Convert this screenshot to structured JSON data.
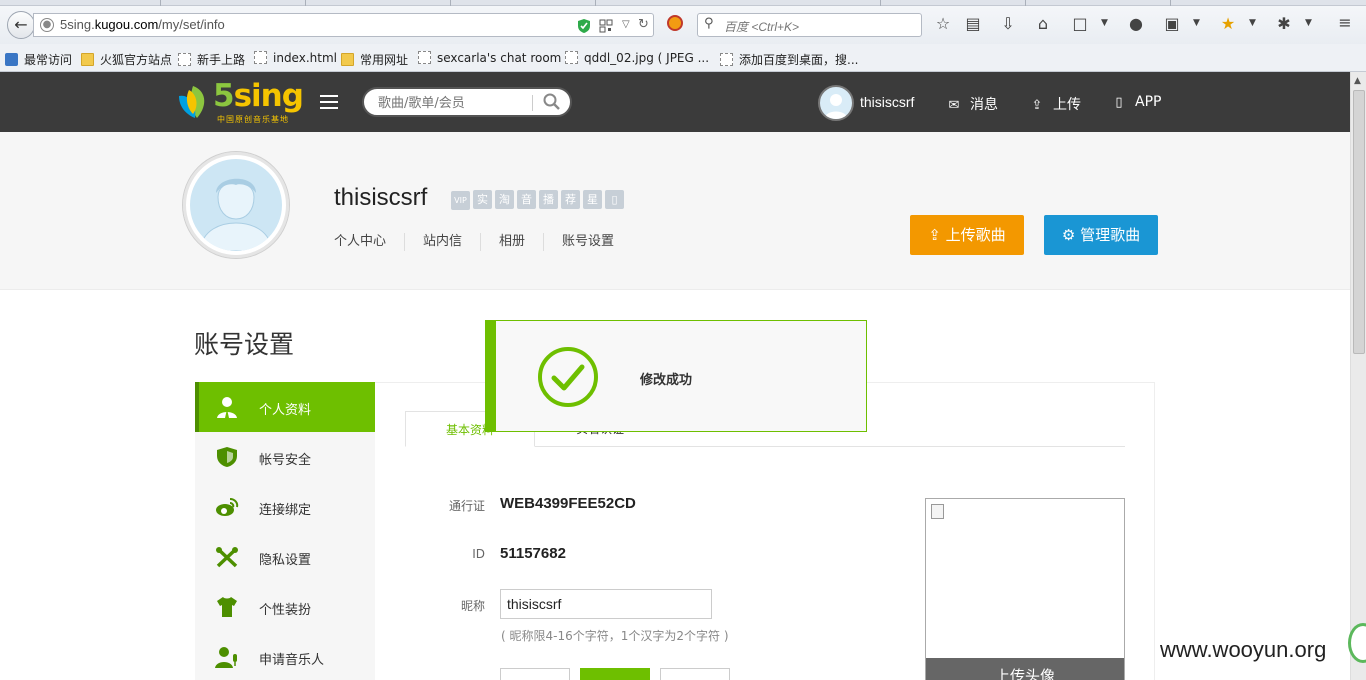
{
  "browser": {
    "url_prefix": "5sing.",
    "url_domain": "kugou.com",
    "url_path": "/my/set/info",
    "search_placeholder": "百度 <Ctrl+K>",
    "bookmarks": [
      "最常访问",
      "火狐官方站点",
      "新手上路",
      "index.html",
      "常用网址",
      "sexcarla's chat room",
      "qddl_02.jpg ( JPEG ...",
      "添加百度到桌面，搜..."
    ]
  },
  "header": {
    "logo_text_five": "5",
    "logo_text_sing": "sing",
    "logo_tagline": "中国原创音乐基地",
    "search_placeholder": "歌曲/歌单/会员",
    "username": "thisiscsrf",
    "messages": "消息",
    "upload": "上传",
    "app": "APP"
  },
  "profile": {
    "name": "thisiscsrf",
    "badges": [
      "VIP",
      "实",
      "淘",
      "音",
      "播",
      "荐",
      "星",
      "▯"
    ],
    "nav": [
      "个人中心",
      "站内信",
      "相册",
      "账号设置"
    ],
    "upload_song": "上传歌曲",
    "manage_songs": "管理歌曲"
  },
  "page": {
    "title": "账号设置"
  },
  "menu": {
    "items": [
      "个人资料",
      "帐号安全",
      "连接绑定",
      "隐私设置",
      "个性装扮",
      "申请音乐人"
    ]
  },
  "tabs": {
    "basic": "基本资料",
    "second": "实名认证"
  },
  "form": {
    "passport_label": "通行证",
    "passport_value": "WEB4399FEE52CD",
    "id_label": "ID",
    "id_value": "51157682",
    "nick_label": "昵称",
    "nick_value": "thisiscsrf",
    "nick_hint": "( 昵称限4-16个字符，1个汉字为2个字符 )",
    "upload_avatar": "上传头像"
  },
  "toast": {
    "message": "修改成功"
  },
  "watermark": "www.wooyun.org",
  "colors": {
    "brand_green": "#6ebf00",
    "orange": "#f39800",
    "blue": "#1a96d4",
    "header_bg": "#3b3b3b"
  }
}
